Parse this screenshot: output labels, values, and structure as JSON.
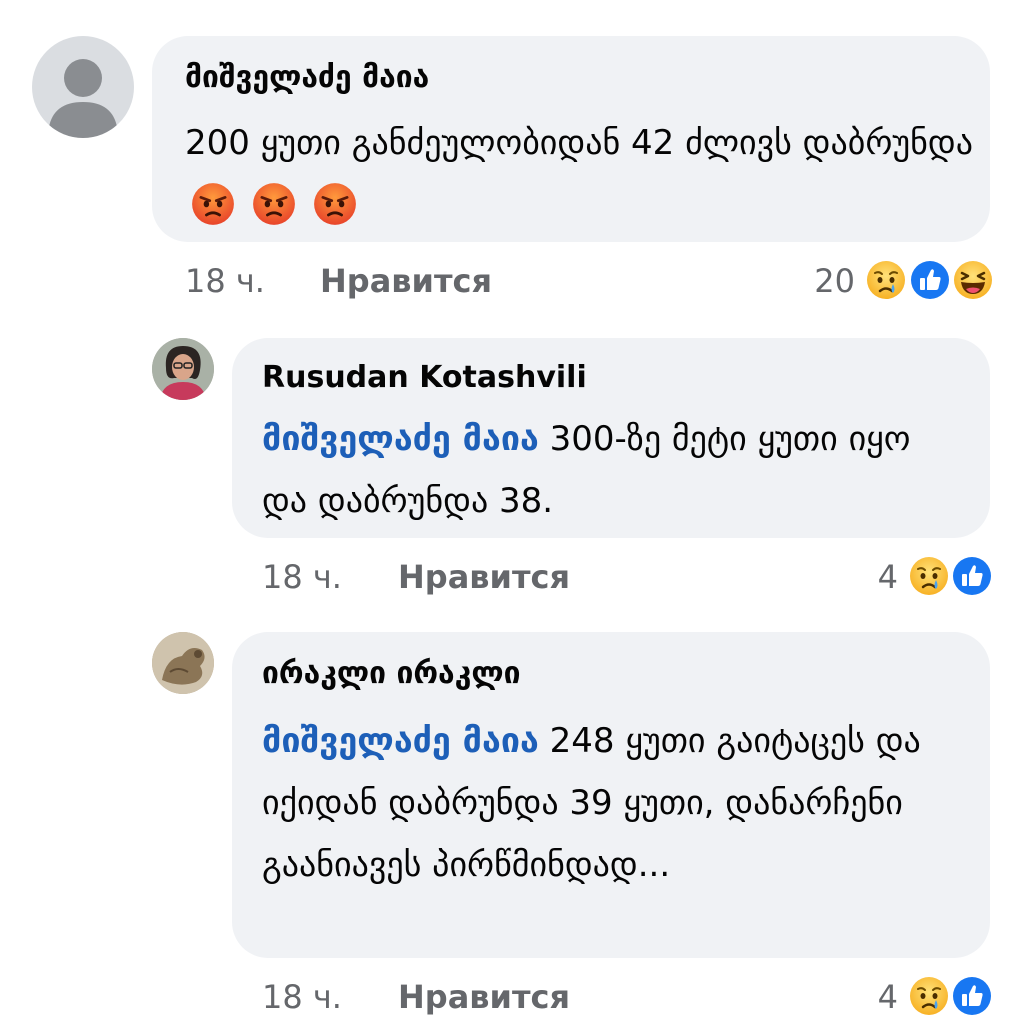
{
  "comments": [
    {
      "author": "მიშველაძე მაია",
      "text": "200 ყუთი განძეულობიდან 42 ძლივს დაბრუნდა",
      "inline_emojis": [
        "angry-face-icon",
        "angry-face-icon",
        "angry-face-icon"
      ],
      "time": "18 ч.",
      "like_label": "Нравится",
      "reaction_count": "20",
      "reactions": [
        "sad-face-icon",
        "like-icon",
        "laughing-face-icon"
      ]
    },
    {
      "author": "Rusudan Kotashvili",
      "mention": "მიშველაძე მაია",
      "text": "300-ზე მეტი ყუთი იყო და დაბრუნდა 38.",
      "time": "18 ч.",
      "like_label": "Нравится",
      "reaction_count": "4",
      "reactions": [
        "sad-face-icon",
        "like-icon"
      ]
    },
    {
      "author": "ირაკლი ირაკლი",
      "mention": "მიშველაძე მაია",
      "text": "248 ყუთი გაიტაცეს და იქიდან დაბრუნდა 39 ყუთი, დანარჩენი გაანიავეს პირწმინდად...",
      "time": "18 ч.",
      "like_label": "Нравится",
      "reaction_count": "4",
      "reactions": [
        "sad-face-icon",
        "like-icon"
      ]
    }
  ],
  "colors": {
    "bubble": "#f0f2f5",
    "mention": "#1d5fb8",
    "meta": "#65676b",
    "like_blue": "#1877f2"
  }
}
